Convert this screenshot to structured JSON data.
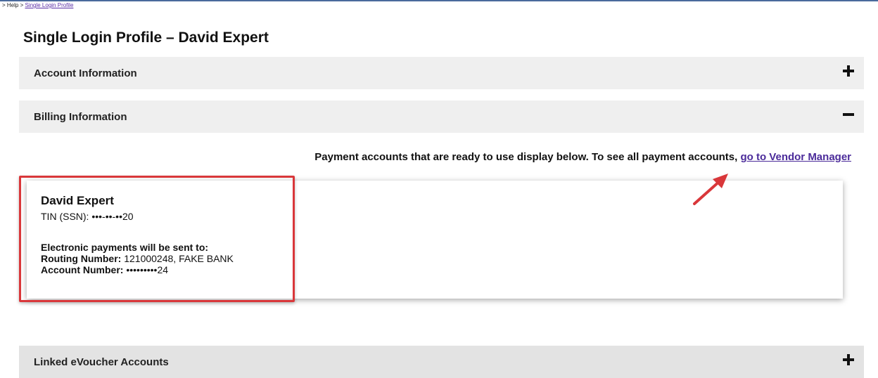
{
  "breadcrumb": {
    "prefix": "> Help > ",
    "link": "Single Login Profile"
  },
  "page_title": "Single Login Profile – David Expert",
  "sections": {
    "account": {
      "label": "Account Information",
      "state": "collapsed"
    },
    "billing": {
      "label": "Billing Information",
      "state": "expanded"
    },
    "linked": {
      "label": "Linked eVoucher Accounts",
      "state": "collapsed"
    }
  },
  "billing": {
    "notice_text": "Payment accounts that are ready to use display below. To see all payment accounts, ",
    "notice_link": "go to Vendor Manager",
    "payee": {
      "name": "David Expert",
      "tin": "TIN (SSN): •••-••-••20",
      "payments_heading": "Electronic payments will be sent to:",
      "routing_label": "Routing Number:",
      "routing_value": " 121000248, FAKE BANK",
      "account_label": "Account Number:",
      "account_value": " •••••••••24"
    }
  },
  "colors": {
    "annotation_red": "#d9373a",
    "link_purple": "#4b2b9a",
    "section_bg": "#efefef"
  },
  "icons": {
    "expand": "plus-icon",
    "collapse": "minus-icon",
    "annotation": "arrow-annotation-icon"
  }
}
